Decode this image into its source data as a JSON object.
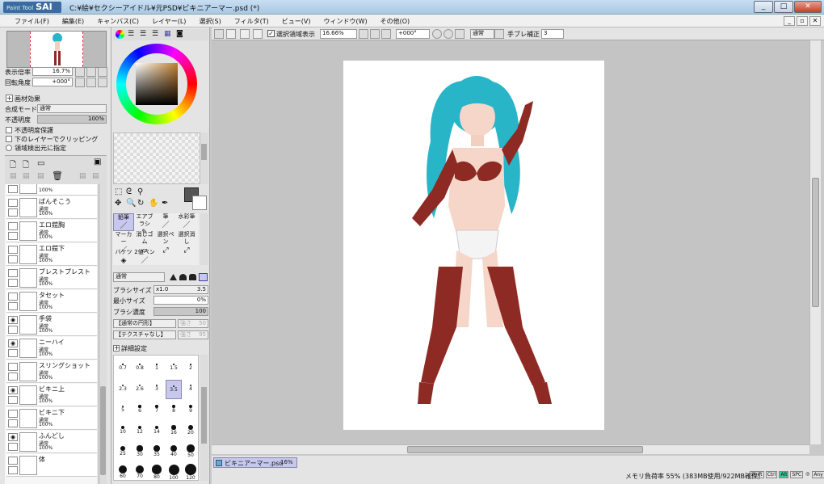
{
  "title_bar": {
    "logo_small": "Paint Tool",
    "logo": "SAI",
    "title": "C:¥絵¥セクシーアイドル¥元PSD¥ビキニアーマー.psd (*)",
    "min": "_",
    "max": "□",
    "close": "✕"
  },
  "menu": [
    "ファイル(F)",
    "編集(E)",
    "キャンバス(C)",
    "レイヤー(L)",
    "選択(S)",
    "フィルタ(T)",
    "ビュー(V)",
    "ウィンドウ(W)",
    "その他(O)"
  ],
  "navigator": {
    "zoom_label": "表示倍率",
    "zoom_value": "16.7%",
    "rotate_label": "回転角度",
    "rotate_value": "+000°"
  },
  "layer_panel": {
    "paper_effect": "画材効果",
    "blend_label": "合成モード",
    "blend_value": "通常",
    "opacity_label": "不透明度",
    "opacity_value": "100%",
    "opacity_fraction": 1.0,
    "check1": "不透明度保護",
    "check2": "下のレイヤーでクリッピング",
    "check3": "領域検出元に指定",
    "layers": [
      {
        "name": "",
        "mode": "",
        "opacity": "100%",
        "visible": false
      },
      {
        "name": "ばんそこう",
        "mode": "通常",
        "opacity": "100%",
        "visible": false
      },
      {
        "name": "エロ鎧胸",
        "mode": "通常",
        "opacity": "100%",
        "visible": false
      },
      {
        "name": "エロ鎧下",
        "mode": "通常",
        "opacity": "100%",
        "visible": false
      },
      {
        "name": "ブレストプレスト",
        "mode": "通常",
        "opacity": "100%",
        "visible": false
      },
      {
        "name": "タセット",
        "mode": "通常",
        "opacity": "100%",
        "visible": false
      },
      {
        "name": "手袋",
        "mode": "通常",
        "opacity": "100%",
        "visible": true
      },
      {
        "name": "ニーハイ",
        "mode": "通常",
        "opacity": "100%",
        "visible": true
      },
      {
        "name": "スリングショット",
        "mode": "通常",
        "opacity": "100%",
        "visible": false
      },
      {
        "name": "ビキニ上",
        "mode": "通常",
        "opacity": "100%",
        "visible": true
      },
      {
        "name": "ビキニ下",
        "mode": "通常",
        "opacity": "100%",
        "visible": false
      },
      {
        "name": "ふんどし",
        "mode": "通常",
        "opacity": "100%",
        "visible": true
      },
      {
        "name": "体",
        "mode": "",
        "opacity": "",
        "visible": false
      }
    ]
  },
  "tools": {
    "row1": [
      {
        "label": "鉛筆",
        "icon": "pencil-icon"
      },
      {
        "label": "エアブラシ",
        "icon": "airbrush-icon"
      },
      {
        "label": "筆",
        "icon": "brush-icon"
      },
      {
        "label": "水彩筆",
        "icon": "watercolor-icon"
      }
    ],
    "row2": [
      {
        "label": "マーカー",
        "icon": "marker-icon"
      },
      {
        "label": "消しゴム",
        "icon": "eraser-icon"
      },
      {
        "label": "選択ペン",
        "icon": "select-pen-icon"
      },
      {
        "label": "選択消し",
        "icon": "select-erase-icon"
      }
    ],
    "row3": [
      {
        "label": "バケツ",
        "icon": "bucket-icon"
      },
      {
        "label": "2値ペン",
        "icon": "binary-pen-icon"
      }
    ],
    "mode": "通常",
    "brush_size_label": "ブラシサイズ",
    "brush_size_mult": "x1.0",
    "brush_size_value": "3.5",
    "min_size_label": "最小サイズ",
    "min_size_value": "0%",
    "density_label": "ブラシ濃度",
    "density_value": "100",
    "shape": "【通常の円形】",
    "shape_val": "50",
    "texture": "【テクスチャなし】",
    "texture_val": "95",
    "shape_strength": "強さ",
    "detail": "詳細設定",
    "sizes": [
      "0.7",
      "0.8",
      "1",
      "1.5",
      "2",
      "2.3",
      "2.6",
      "3",
      "3.5",
      "4",
      "5",
      "6",
      "7",
      "8",
      "9",
      "10",
      "12",
      "14",
      "16",
      "20",
      "25",
      "30",
      "35",
      "40",
      "50",
      "60",
      "70",
      "80",
      "100",
      "120"
    ],
    "selected_size": "3.5"
  },
  "canvas_toolbar": {
    "show_selection": "選択領域表示",
    "zoom": "16.66%",
    "angle": "+000°",
    "mode": "通常",
    "stabilizer_label": "手ブレ補正",
    "stabilizer_value": "3"
  },
  "status": {
    "tab_name": "ビキニアーマー.psd",
    "tab_zoom": "16%",
    "memory": "メモリ負荷率 55% (383MB使用/922MB確保)",
    "keys": [
      "Shift",
      "Ctrl",
      "Alt",
      "SPC",
      "Any"
    ]
  },
  "colors": {
    "accent": "#3d6aa0",
    "stocking": "#8e2a24",
    "hair": "#29b5c8",
    "selected_tool": "#c8c8ee"
  }
}
